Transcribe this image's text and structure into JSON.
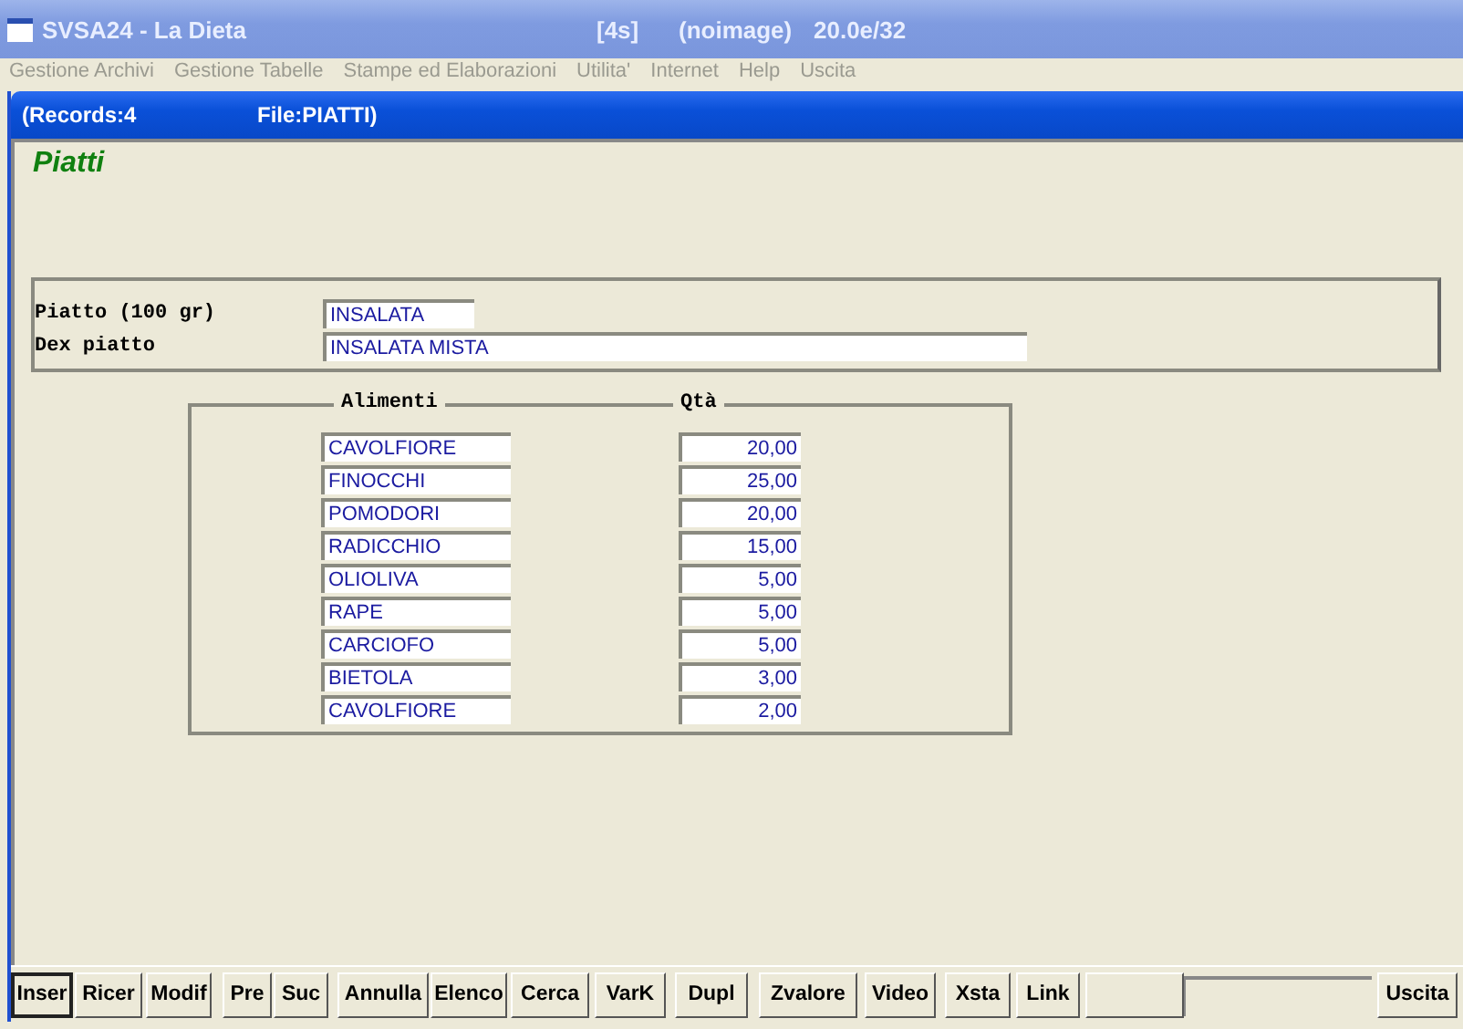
{
  "window": {
    "title": "SVSA24 - La Dieta",
    "info": [
      "[4s]",
      "(noimage)",
      "20.0e/32"
    ]
  },
  "menu": [
    {
      "label": "Gestione Archivi",
      "disabled": true
    },
    {
      "label": "Gestione Tabelle",
      "disabled": true
    },
    {
      "label": "Stampe ed Elaborazioni",
      "disabled": true
    },
    {
      "label": "Utilita'",
      "disabled": true
    },
    {
      "label": "Internet",
      "disabled": true
    },
    {
      "label": "Help",
      "disabled": true
    },
    {
      "label": "Uscita",
      "disabled": true
    }
  ],
  "subwindow": {
    "records": "(Records:4",
    "file": "File:PIATTI)"
  },
  "form_title": "Piatti",
  "fields": [
    {
      "label": "Piatto (100 gr)",
      "value": "INSALATA",
      "kind": "short"
    },
    {
      "label": "Dex piatto",
      "value": "INSALATA MISTA",
      "kind": "long"
    }
  ],
  "ingredients": {
    "columns": [
      "Alimenti",
      "Qtà"
    ],
    "rows": [
      {
        "food": "CAVOLFIORE",
        "qty": "20,00"
      },
      {
        "food": "FINOCCHI",
        "qty": "25,00"
      },
      {
        "food": "POMODORI",
        "qty": "20,00"
      },
      {
        "food": "RADICCHIO",
        "qty": "15,00"
      },
      {
        "food": "OLIOLIVA",
        "qty": "5,00"
      },
      {
        "food": "RAPE",
        "qty": "5,00"
      },
      {
        "food": "CARCIOFO",
        "qty": "5,00"
      },
      {
        "food": "BIETOLA",
        "qty": "3,00"
      },
      {
        "food": "CAVOLFIORE",
        "qty": "2,00"
      }
    ]
  },
  "buttons": [
    {
      "label": "Inser",
      "selected": true
    },
    {
      "label": "Ricer",
      "selected": false
    },
    {
      "label": "Modif",
      "selected": false
    },
    {
      "label": "Pre",
      "selected": false
    },
    {
      "label": "Suc",
      "selected": false
    },
    {
      "label": "Annulla",
      "selected": false
    },
    {
      "label": "Elenco",
      "selected": false
    },
    {
      "label": "Cerca",
      "selected": false
    },
    {
      "label": "VarK",
      "selected": false
    },
    {
      "label": "Dupl",
      "selected": false
    },
    {
      "label": "Zvalore",
      "selected": false
    },
    {
      "label": "Video",
      "selected": false
    },
    {
      "label": "Xsta",
      "selected": false
    },
    {
      "label": "Link",
      "selected": false
    }
  ],
  "exit_button": "Uscita"
}
